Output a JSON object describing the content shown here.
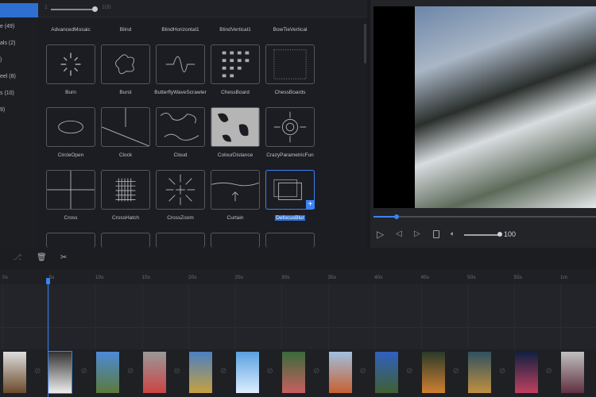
{
  "sidebar": {
    "items": [
      {
        "label": ""
      },
      {
        "label": "e (49)"
      },
      {
        "label": "als (2)"
      },
      {
        "label": ")"
      },
      {
        "label": "eel (8)"
      },
      {
        "label": "s (10)"
      },
      {
        "label": "9)"
      }
    ]
  },
  "grid_toolbar": {
    "slider_min": "1",
    "slider_max": "100",
    "slider_value_percent": 100
  },
  "transitions": [
    "AdvancedMosaic",
    "Blind",
    "BlindHorizontal1",
    "BlindVertical1",
    "BowTieVertical",
    "Burn",
    "Burst",
    "ButterflyWaveScrawler",
    "ChessBoard",
    "ChessBoards",
    "CircleOpen",
    "Clock",
    "Cloud",
    "ColourDistance",
    "CrazyParametricFun",
    "Cross",
    "CrossHatch",
    "CrossZoom",
    "Curtain",
    "DefocusBlur"
  ],
  "selected_transition": "DefocusBlur",
  "player": {
    "progress_percent": 11,
    "volume": "100",
    "volume_percent": 100
  },
  "timeline": {
    "ticks": [
      "0s",
      "5s",
      "10s",
      "15s",
      "20s",
      "25s",
      "30s",
      "35s",
      "40s",
      "45s",
      "50s",
      "55s",
      "1m"
    ],
    "playhead": "5s",
    "clip_count": 13
  },
  "colors": {
    "accent": "#2f6fd1",
    "background": "#1a1b1f"
  }
}
